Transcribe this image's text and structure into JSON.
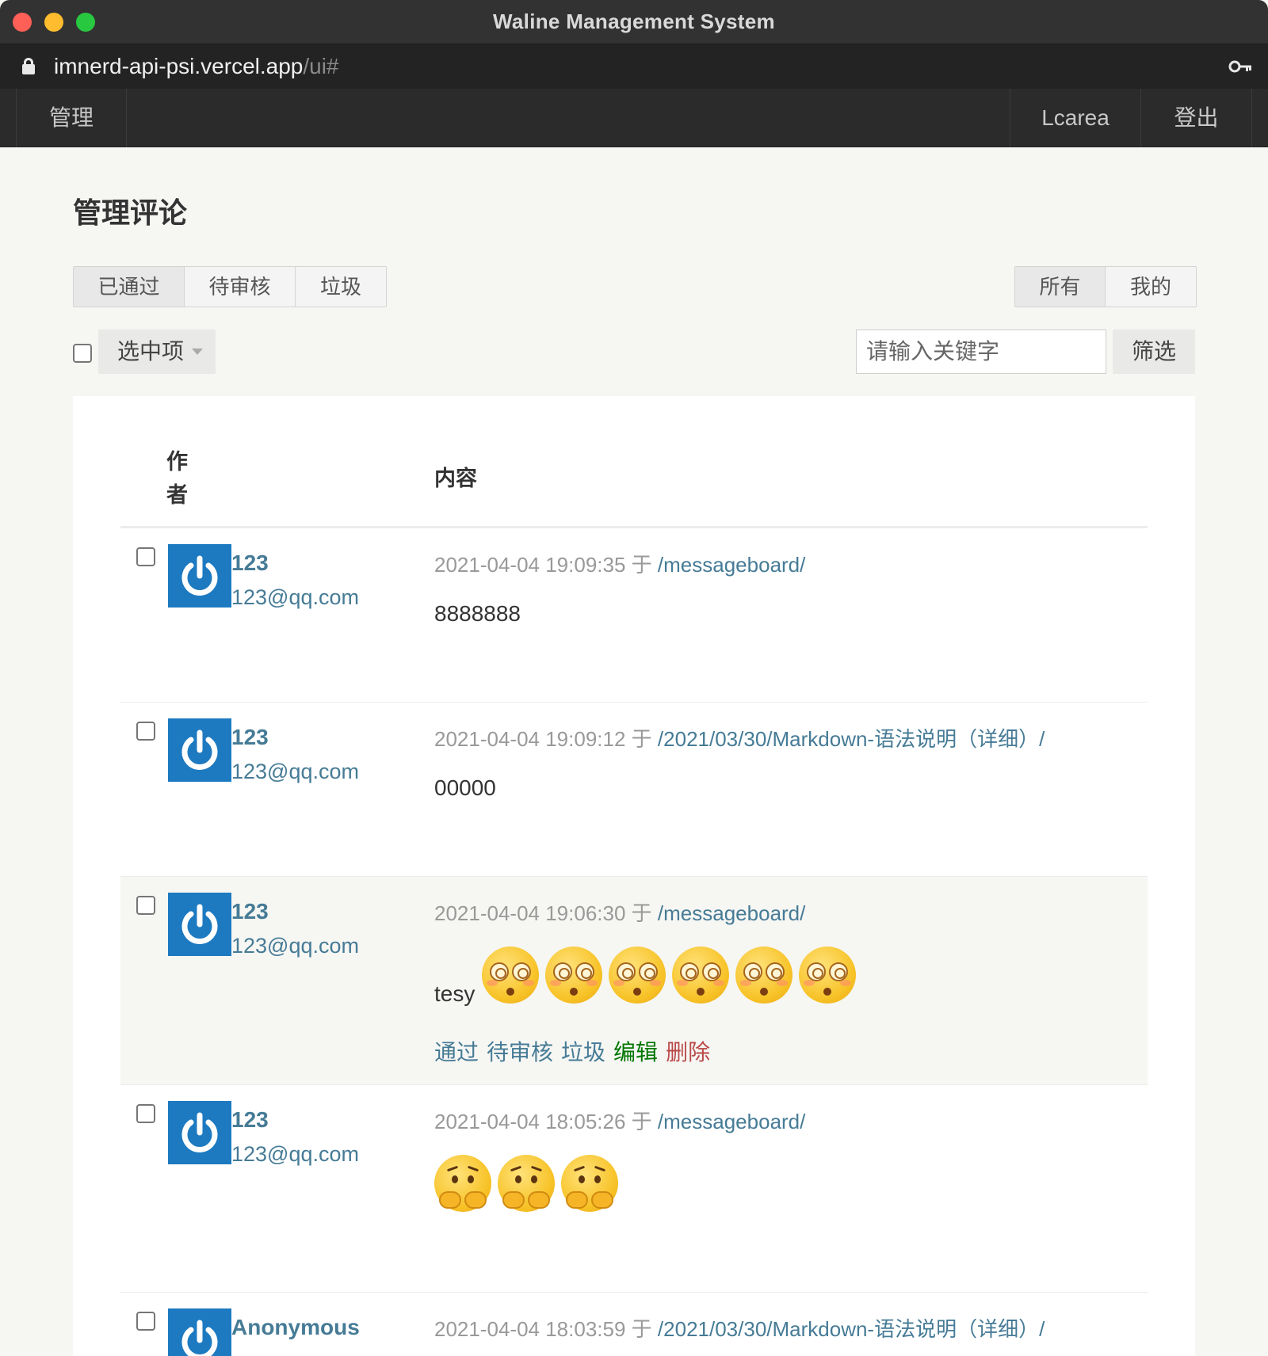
{
  "window": {
    "title": "Waline Management System"
  },
  "urlbar": {
    "host": "imnerd-api-psi.vercel.app",
    "path": "/ui#"
  },
  "nav": {
    "manage": "管理",
    "user": "Lcarea",
    "logout": "登出"
  },
  "page": {
    "title": "管理评论"
  },
  "status_tabs": [
    "已通过",
    "待审核",
    "垃圾"
  ],
  "owner_tabs": [
    "所有",
    "我的"
  ],
  "toolbar": {
    "selected_label": "选中项",
    "search_placeholder": "请输入关键字",
    "filter_label": "筛选"
  },
  "table": {
    "col_author": "作者",
    "col_content": "内容"
  },
  "comments": [
    {
      "name": "123",
      "mail": "123@qq.com",
      "time": "2021-04-04 19:09:35",
      "sep": "于",
      "link": "/messageboard/",
      "text": "8888888"
    },
    {
      "name": "123",
      "mail": "123@qq.com",
      "time": "2021-04-04 19:09:12",
      "sep": "于",
      "link": "/2021/03/30/Markdown-语法说明（详细）/",
      "text": "00000"
    },
    {
      "name": "123",
      "mail": "123@qq.com",
      "time": "2021-04-04 19:06:30",
      "sep": "于",
      "link": "/messageboard/",
      "text": "tesy",
      "emoji": "dizzy-face-emoji",
      "emoji_count": 6
    },
    {
      "name": "123",
      "mail": "123@qq.com",
      "time": "2021-04-04 18:05:26",
      "sep": "于",
      "link": "/messageboard/",
      "text": "",
      "emoji": "scared-face-emoji",
      "emoji_count": 3
    },
    {
      "name": "Anonymous",
      "mail": "",
      "time": "2021-04-04 18:03:59",
      "sep": "于",
      "link": "/2021/03/30/Markdown-语法说明（详细）/",
      "text": ""
    }
  ],
  "row_actions": {
    "approve": "通过",
    "pending": "待审核",
    "spam": "垃圾",
    "edit": "编辑",
    "delete": "删除"
  },
  "colors": {
    "link": "#467b96",
    "avatar_bg": "#1d7ac1",
    "edit": "#007700",
    "delete": "#b94a48"
  }
}
